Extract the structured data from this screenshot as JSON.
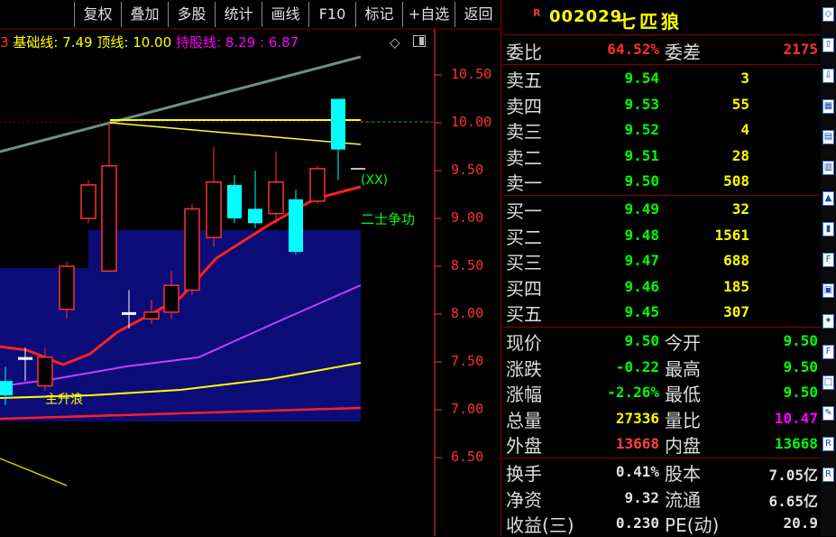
{
  "toolbar": {
    "buttons": [
      "复权",
      "叠加",
      "多股",
      "统计",
      "画线",
      "F10",
      "标记",
      "+自选",
      "返回"
    ]
  },
  "indicator": {
    "prefix": "3",
    "base_label": "基础线:",
    "base_value": "7.49",
    "top_label": "顶线:",
    "top_value": "10.00",
    "hold_label": "持股线:",
    "hold_value": "8.29",
    "sep": ":",
    "hold_value2": "6.87"
  },
  "price_axis": [
    "10.50",
    "10.00",
    "9.50",
    "9.00",
    "8.50",
    "8.00",
    "7.50",
    "7.00",
    "6.50"
  ],
  "chart_text": {
    "xx": "(XX)",
    "erzheng": "二士争功",
    "zhusheng": "主升浪"
  },
  "stock": {
    "r_badge": "R",
    "code": "002029",
    "name": "七匹狼"
  },
  "ratio": {
    "label": "委比",
    "value": "64.52%",
    "diff_label": "委差",
    "diff_value": "2175"
  },
  "asks": [
    {
      "label": "卖五",
      "price": "9.54",
      "vol": "3"
    },
    {
      "label": "卖四",
      "price": "9.53",
      "vol": "55"
    },
    {
      "label": "卖三",
      "price": "9.52",
      "vol": "4"
    },
    {
      "label": "卖二",
      "price": "9.51",
      "vol": "28"
    },
    {
      "label": "卖一",
      "price": "9.50",
      "vol": "508"
    }
  ],
  "bids": [
    {
      "label": "买一",
      "price": "9.49",
      "vol": "32"
    },
    {
      "label": "买二",
      "price": "9.48",
      "vol": "1561"
    },
    {
      "label": "买三",
      "price": "9.47",
      "vol": "688"
    },
    {
      "label": "买四",
      "price": "9.46",
      "vol": "185"
    },
    {
      "label": "买五",
      "price": "9.45",
      "vol": "307"
    }
  ],
  "stats": [
    {
      "l1": "现价",
      "v1": "9.50",
      "c1": "#00ff00",
      "l2": "今开",
      "v2": "9.50",
      "c2": "#00ff00"
    },
    {
      "l1": "涨跌",
      "v1": "-0.22",
      "c1": "#00ff00",
      "l2": "最高",
      "v2": "9.50",
      "c2": "#00ff00"
    },
    {
      "l1": "涨幅",
      "v1": "-2.26%",
      "c1": "#00ff00",
      "l2": "最低",
      "v2": "9.50",
      "c2": "#00ff00"
    },
    {
      "l1": "总量",
      "v1": "27336",
      "c1": "#ffff00",
      "l2": "量比",
      "v2": "10.47",
      "c2": "#ff00ff"
    },
    {
      "l1": "外盘",
      "v1": "13668",
      "c1": "#ff4040",
      "l2": "内盘",
      "v2": "13668",
      "c2": "#00ff00"
    }
  ],
  "stats2": [
    {
      "l1": "换手",
      "v1": "0.41%",
      "l2": "股本",
      "v2": "7.05亿"
    },
    {
      "l1": "净资",
      "v1": "9.32",
      "l2": "流通",
      "v2": "6.65亿"
    },
    {
      "l1": "收益(三)",
      "v1": "0.230",
      "l2": "PE(动)",
      "v2": "20.9"
    }
  ],
  "colors": {
    "up": "#ff3030",
    "down": "#00ffff",
    "green": "#00ff00",
    "yellow": "#ffff00",
    "magenta": "#ff00ff",
    "axis": "#ff3030",
    "fill": "#0d0d7a"
  }
}
